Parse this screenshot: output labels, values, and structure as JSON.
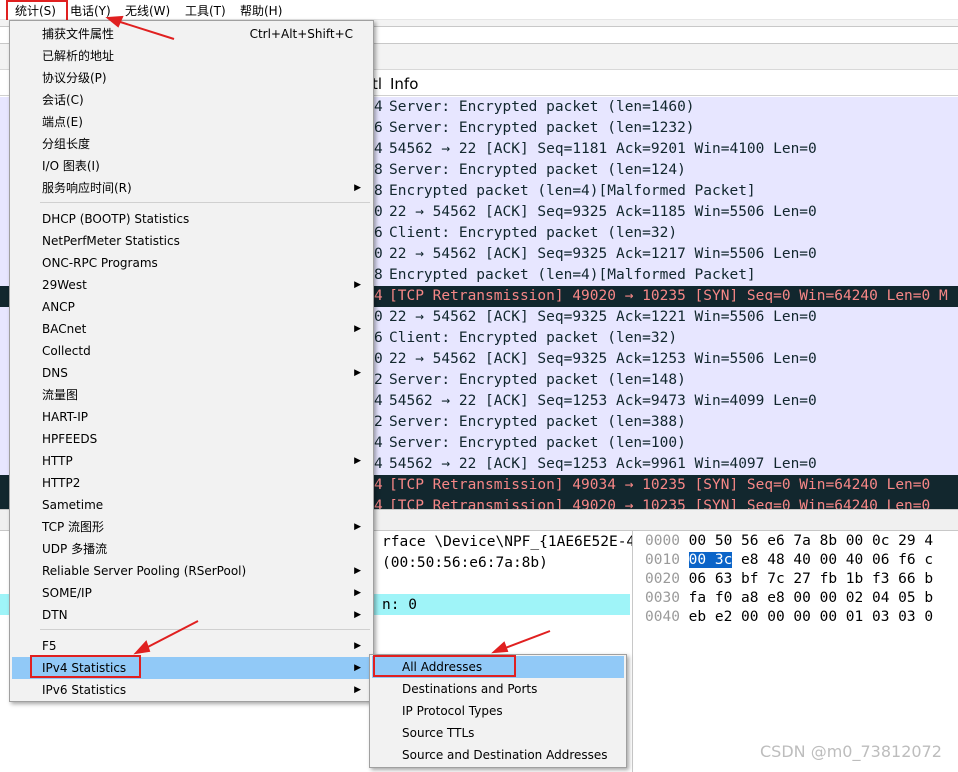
{
  "menubar": {
    "items": [
      "统计(S)",
      "电话(Y)",
      "无线(W)",
      "工具(T)",
      "帮助(H)"
    ]
  },
  "packet_list": {
    "col_ttl": "tl",
    "col_info": "Info",
    "rows": [
      {
        "ttl": "4",
        "info": "Server: Encrypted packet (len=1460)",
        "kind": "normal"
      },
      {
        "ttl": "6",
        "info": "Server: Encrypted packet (len=1232)",
        "kind": "normal"
      },
      {
        "ttl": "4",
        "info": "54562 → 22 [ACK] Seq=1181 Ack=9201 Win=4100 Len=0",
        "kind": "normal"
      },
      {
        "ttl": "8",
        "info": "Server: Encrypted packet (len=124)",
        "kind": "normal"
      },
      {
        "ttl": "8",
        "info": "Encrypted packet (len=4)[Malformed Packet]",
        "kind": "normal"
      },
      {
        "ttl": "0",
        "info": "22 → 54562 [ACK] Seq=9325 Ack=1185 Win=5506 Len=0",
        "kind": "normal"
      },
      {
        "ttl": "6",
        "info": "Client: Encrypted packet (len=32)",
        "kind": "normal"
      },
      {
        "ttl": "0",
        "info": "22 → 54562 [ACK] Seq=9325 Ack=1217 Win=5506 Len=0",
        "kind": "normal"
      },
      {
        "ttl": "8",
        "info": "Encrypted packet (len=4)[Malformed Packet]",
        "kind": "normal"
      },
      {
        "ttl": "4",
        "info": "[TCP Retransmission] 49020 → 10235 [SYN] Seq=0 Win=64240 Len=0 M",
        "kind": "bad"
      },
      {
        "ttl": "0",
        "info": "22 → 54562 [ACK] Seq=9325 Ack=1221 Win=5506 Len=0",
        "kind": "normal"
      },
      {
        "ttl": "6",
        "info": "Client: Encrypted packet (len=32)",
        "kind": "normal"
      },
      {
        "ttl": "0",
        "info": "22 → 54562 [ACK] Seq=9325 Ack=1253 Win=5506 Len=0",
        "kind": "normal"
      },
      {
        "ttl": "2",
        "info": "Server: Encrypted packet (len=148)",
        "kind": "normal"
      },
      {
        "ttl": "4",
        "info": "54562 → 22 [ACK] Seq=1253 Ack=9473 Win=4099 Len=0",
        "kind": "normal"
      },
      {
        "ttl": "2",
        "info": "Server: Encrypted packet (len=388)",
        "kind": "normal"
      },
      {
        "ttl": "4",
        "info": "Server: Encrypted packet (len=100)",
        "kind": "normal"
      },
      {
        "ttl": "4",
        "info": "54562 → 22 [ACK] Seq=1253 Ack=9961 Win=4097 Len=0",
        "kind": "normal"
      },
      {
        "ttl": "4",
        "info": "[TCP Retransmission] 49034 → 10235 [SYN] Seq=0 Win=64240 Len=0",
        "kind": "bad"
      },
      {
        "ttl": "4",
        "info": "[TCP Retransmission] 49020 → 10235 [SYN] Seq=0 Win=64240 Len=0",
        "kind": "bad"
      }
    ]
  },
  "details": {
    "lines": [
      "rface \\Device\\NPF_{1AE6E52E-4",
      "(00:50:56:e6:7a:8b)",
      "",
      "n: 0"
    ]
  },
  "bytes": {
    "rows": [
      {
        "offset": "0000",
        "hex_sel": "",
        "hex": "00 50 56 e6 7a 8b 00 0c  29 4"
      },
      {
        "offset": "0010",
        "hex_sel": "00 3c",
        "hex": " e8 48 40 00 40 06  f6 c"
      },
      {
        "offset": "0020",
        "hex_sel": "",
        "hex": "06 63 bf 7c 27 fb 1b f3  66 b"
      },
      {
        "offset": "0030",
        "hex_sel": "",
        "hex": "fa f0 a8 e8 00 00 02 04  05 b"
      },
      {
        "offset": "0040",
        "hex_sel": "",
        "hex": "eb e2 00 00 00 00 01 03  03 0"
      }
    ]
  },
  "stats_menu": {
    "items": [
      {
        "label": "捕获文件属性",
        "shortcut": "Ctrl+Alt+Shift+C",
        "submenu": false
      },
      {
        "label": "已解析的地址",
        "shortcut": "",
        "submenu": false
      },
      {
        "label": "协议分级(P)",
        "shortcut": "",
        "submenu": false
      },
      {
        "label": "会话(C)",
        "shortcut": "",
        "submenu": false
      },
      {
        "label": "端点(E)",
        "shortcut": "",
        "submenu": false
      },
      {
        "label": "分组长度",
        "shortcut": "",
        "submenu": false
      },
      {
        "label": "I/O 图表(I)",
        "shortcut": "",
        "submenu": false
      },
      {
        "label": "服务响应时间(R)",
        "shortcut": "",
        "submenu": true
      },
      {
        "sep": true
      },
      {
        "label": "DHCP (BOOTP) Statistics",
        "shortcut": "",
        "submenu": false
      },
      {
        "label": "NetPerfMeter Statistics",
        "shortcut": "",
        "submenu": false
      },
      {
        "label": "ONC-RPC Programs",
        "shortcut": "",
        "submenu": false
      },
      {
        "label": "29West",
        "shortcut": "",
        "submenu": true
      },
      {
        "label": "ANCP",
        "shortcut": "",
        "submenu": false
      },
      {
        "label": "BACnet",
        "shortcut": "",
        "submenu": true
      },
      {
        "label": "Collectd",
        "shortcut": "",
        "submenu": false
      },
      {
        "label": "DNS",
        "shortcut": "",
        "submenu": true
      },
      {
        "label": "流量图",
        "shortcut": "",
        "submenu": false
      },
      {
        "label": "HART-IP",
        "shortcut": "",
        "submenu": false
      },
      {
        "label": "HPFEEDS",
        "shortcut": "",
        "submenu": false
      },
      {
        "label": "HTTP",
        "shortcut": "",
        "submenu": true
      },
      {
        "label": "HTTP2",
        "shortcut": "",
        "submenu": false
      },
      {
        "label": "Sametime",
        "shortcut": "",
        "submenu": false
      },
      {
        "label": "TCP 流图形",
        "shortcut": "",
        "submenu": true
      },
      {
        "label": "UDP 多播流",
        "shortcut": "",
        "submenu": false
      },
      {
        "label": "Reliable Server Pooling (RSerPool)",
        "shortcut": "",
        "submenu": true
      },
      {
        "label": "SOME/IP",
        "shortcut": "",
        "submenu": true
      },
      {
        "label": "DTN",
        "shortcut": "",
        "submenu": true
      },
      {
        "sep": true
      },
      {
        "label": "F5",
        "shortcut": "",
        "submenu": true
      },
      {
        "label": "IPv4 Statistics",
        "shortcut": "",
        "submenu": true,
        "active": true
      },
      {
        "label": "IPv6 Statistics",
        "shortcut": "",
        "submenu": true
      }
    ]
  },
  "ipv4_submenu": {
    "items": [
      {
        "label": "All Addresses",
        "active": true
      },
      {
        "label": "Destinations and Ports"
      },
      {
        "label": "IP Protocol Types"
      },
      {
        "label": "Source TTLs"
      },
      {
        "label": "Source and Destination Addresses"
      }
    ]
  },
  "watermark": "CSDN @m0_73812072",
  "colors": {
    "row_normal_bg": "#e7e6ff",
    "row_bad_bg": "#12272e",
    "row_bad_fg": "#f78787",
    "menu_highlight": "#91c9f7",
    "annotation_red": "#e02020"
  }
}
